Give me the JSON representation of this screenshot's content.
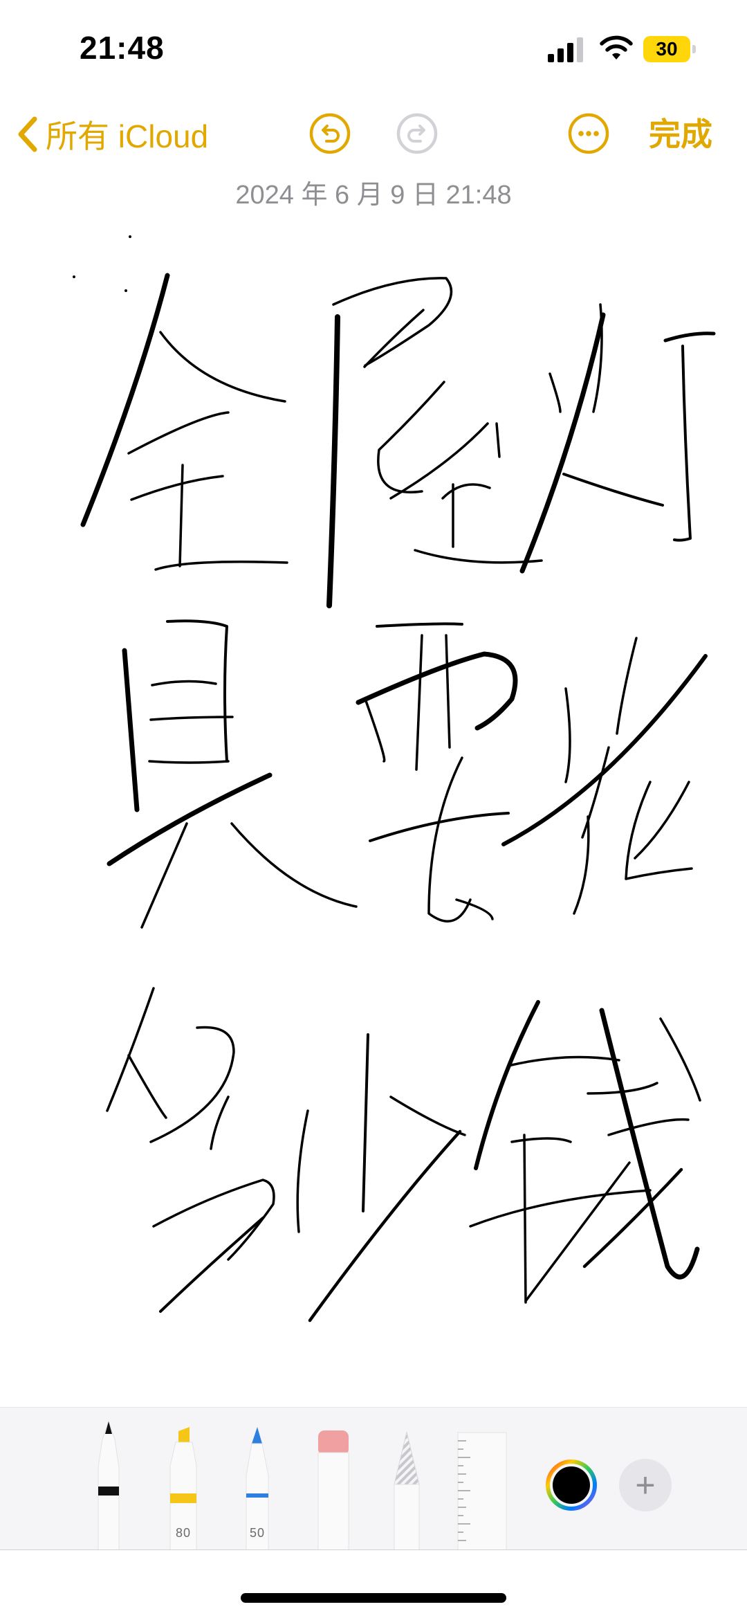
{
  "status_bar": {
    "time": "21:48",
    "battery_level": "30",
    "icons": [
      "cellular-signal-icon",
      "wifi-icon",
      "battery-icon"
    ]
  },
  "nav": {
    "back_label": "所有 iCloud",
    "done_label": "完成",
    "icons": [
      "chevron-left-icon",
      "undo-icon",
      "redo-icon",
      "more-icon"
    ]
  },
  "note": {
    "date": "2024 年 6 月 9 日 21:48"
  },
  "tools": {
    "items": [
      {
        "name": "pen",
        "icon": "pen-tool-icon",
        "ink": "#111111"
      },
      {
        "name": "marker",
        "icon": "marker-tool-icon",
        "ink": "#f5c518",
        "size": "80"
      },
      {
        "name": "pencil",
        "icon": "pencil-tool-icon",
        "ink": "#2f7fe0",
        "size": "50"
      },
      {
        "name": "eraser",
        "icon": "eraser-tool-icon",
        "ink": "#f0a0a0"
      },
      {
        "name": "lasso",
        "icon": "lasso-tool-icon"
      },
      {
        "name": "ruler",
        "icon": "ruler-tool-icon"
      }
    ],
    "selected_color": "#000000",
    "add_label": "+"
  },
  "colors": {
    "accent": "#e0a800",
    "secondary_text": "#8e8e93",
    "ink": "#000000"
  }
}
